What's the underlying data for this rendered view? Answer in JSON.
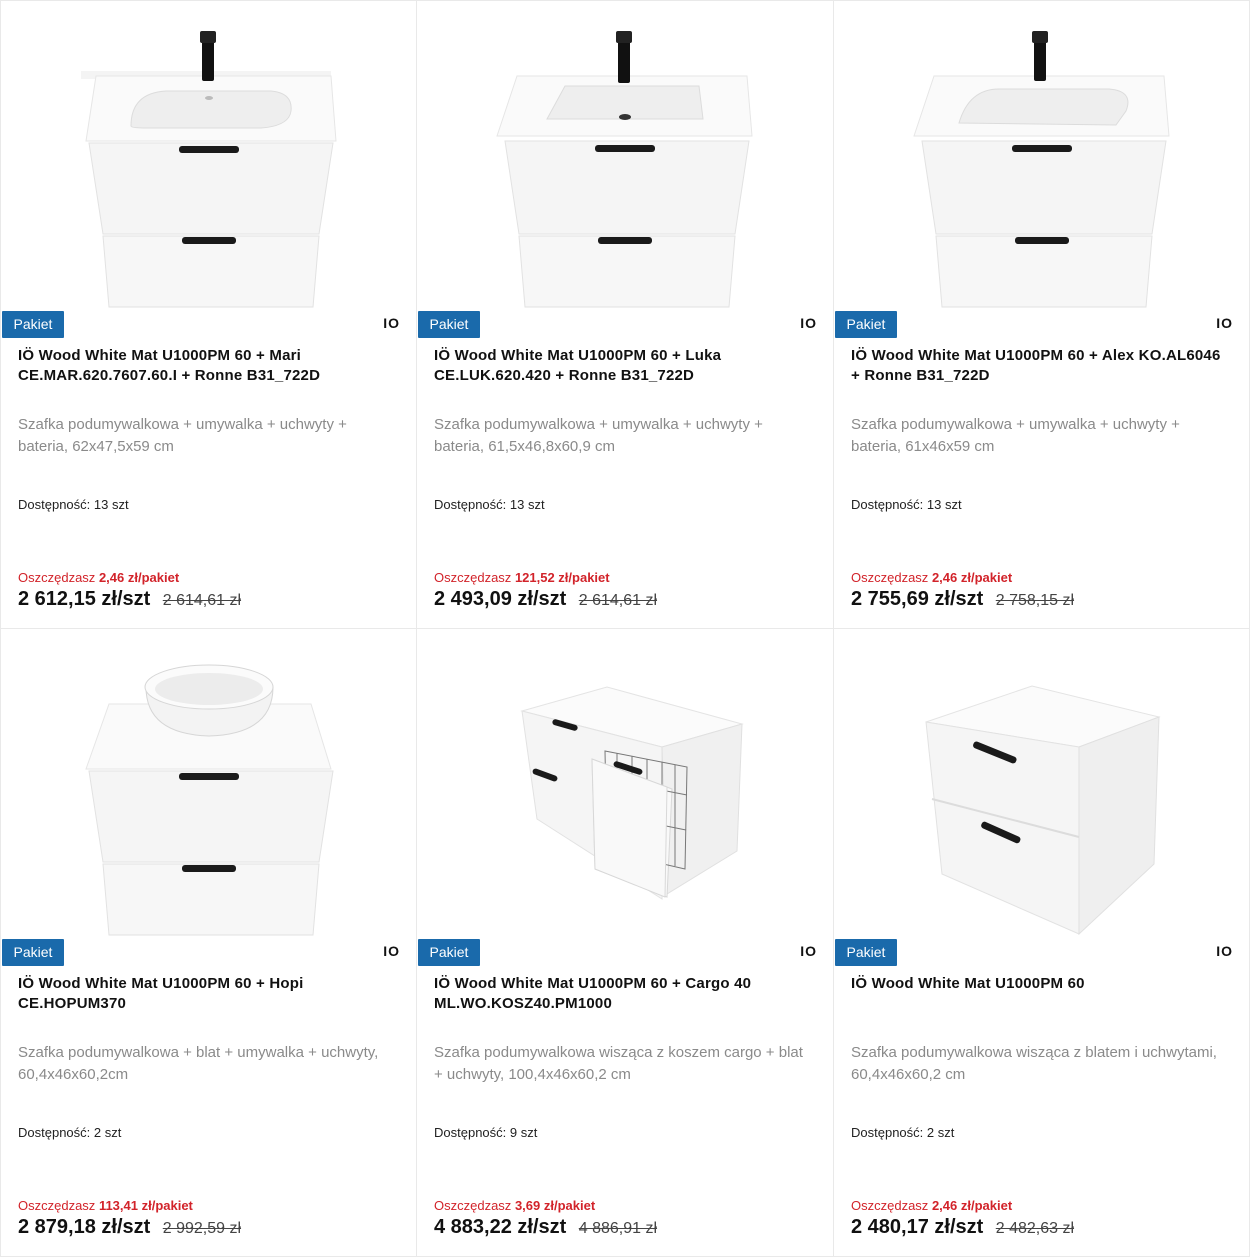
{
  "products": [
    {
      "badge": "Pakiet",
      "brand": "IO",
      "image": "vanity-unit-with-basin-and-black-tap",
      "title": "IÖ Wood White Mat U1000PM 60 + Mari CE.MAR.620.7607.60.I + Ronne B31_722D",
      "description": "Szafka podumywalkowa + umywalka + uchwyty + bateria, 62x47,5x59 cm",
      "availability_label": "Dostępność:",
      "availability_value": "13 szt",
      "save_label": "Oszczędzasz",
      "save_value": "2,46 zł/pakiet",
      "price": "2 612,15 zł/szt",
      "old_price": "2 614,61 zł"
    },
    {
      "badge": "Pakiet",
      "brand": "IO",
      "image": "vanity-unit-with-basin-and-black-tap",
      "title": "IÖ Wood White Mat U1000PM 60 + Luka CE.LUK.620.420 + Ronne B31_722D",
      "description": "Szafka podumywalkowa + umywalka + uchwyty + bateria, 61,5x46,8x60,9 cm",
      "availability_label": "Dostępność:",
      "availability_value": "13 szt",
      "save_label": "Oszczędzasz",
      "save_value": "121,52 zł/pakiet",
      "price": "2 493,09 zł/szt",
      "old_price": "2 614,61 zł"
    },
    {
      "badge": "Pakiet",
      "brand": "IO",
      "image": "vanity-unit-with-basin-and-black-tap",
      "title": "IÖ Wood White Mat U1000PM 60 + Alex KO.AL6046 + Ronne B31_722D",
      "description": "Szafka podumywalkowa + umywalka + uchwyty + bateria, 61x46x59 cm",
      "availability_label": "Dostępność:",
      "availability_value": "13 szt",
      "save_label": "Oszczędzasz",
      "save_value": "2,46 zł/pakiet",
      "price": "2 755,69 zł/szt",
      "old_price": "2 758,15 zł"
    },
    {
      "badge": "Pakiet",
      "brand": "IO",
      "image": "vanity-unit-with-countertop-bowl",
      "title": "IÖ Wood White Mat U1000PM 60 + Hopi CE.HOPUM370",
      "description": "Szafka podumywalkowa + blat + umywalka + uchwyty, 60,4x46x60,2cm",
      "availability_label": "Dostępność:",
      "availability_value": "2 szt",
      "save_label": "Oszczędzasz",
      "save_value": "113,41 zł/pakiet",
      "price": "2 879,18 zł/szt",
      "old_price": "2 992,59 zł"
    },
    {
      "badge": "Pakiet",
      "brand": "IO",
      "image": "wide-cabinet-with-cargo-basket",
      "title": "IÖ Wood White Mat U1000PM 60 + Cargo 40 ML.WO.KOSZ40.PM1000",
      "description": "Szafka podumywalkowa wisząca z koszem cargo + blat + uchwyty, 100,4x46x60,2 cm",
      "availability_label": "Dostępność:",
      "availability_value": "9 szt",
      "save_label": "Oszczędzasz",
      "save_value": "3,69 zł/pakiet",
      "price": "4 883,22 zł/szt",
      "old_price": "4 886,91 zł"
    },
    {
      "badge": "Pakiet",
      "brand": "IO",
      "image": "hanging-cabinet-with-top",
      "title": "IÖ Wood White Mat U1000PM 60",
      "description": "Szafka podumywalkowa wisząca z blatem i uchwytami, 60,4x46x60,2 cm",
      "availability_label": "Dostępność:",
      "availability_value": "2 szt",
      "save_label": "Oszczędzasz",
      "save_value": "2,46 zł/pakiet",
      "price": "2 480,17 zł/szt",
      "old_price": "2 482,63 zł"
    }
  ],
  "colors": {
    "badge_bg": "#1a6aab",
    "save_red": "#d2232a",
    "description_gray": "#8a8a8a"
  }
}
